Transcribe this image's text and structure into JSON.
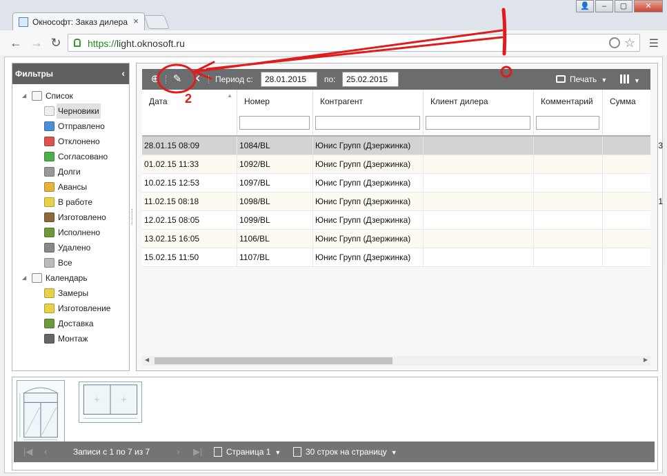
{
  "browser": {
    "tab_title": "Окнософт: Заказ дилера",
    "tab_close": "×",
    "url_scheme": "https://",
    "url_host": "light.oknosoft.ru",
    "window_buttons": [
      "👤",
      "–",
      "▢",
      "✕"
    ]
  },
  "sidebar": {
    "title": "Фильтры",
    "collapse_glyph": "‹",
    "groups": [
      {
        "label": "Список",
        "icon": "list-icon",
        "items": [
          {
            "label": "Черновики",
            "icon": "draft-icon",
            "color": "#eeeeee"
          },
          {
            "label": "Отправлено",
            "icon": "upload-icon",
            "color": "#4a90d9"
          },
          {
            "label": "Отклонено",
            "icon": "rejected-icon",
            "color": "#d9534f"
          },
          {
            "label": "Согласовано",
            "icon": "approved-icon",
            "color": "#4cae4c"
          },
          {
            "label": "Долги",
            "icon": "debt-icon",
            "color": "#999999"
          },
          {
            "label": "Авансы",
            "icon": "coins-icon",
            "color": "#e5b53a"
          },
          {
            "label": "В работе",
            "icon": "work-icon",
            "color": "#e8d24a"
          },
          {
            "label": "Изготовлено",
            "icon": "factory-icon",
            "color": "#8a6a3a"
          },
          {
            "label": "Исполнено",
            "icon": "truck-icon",
            "color": "#6a9a3a"
          },
          {
            "label": "Удалено",
            "icon": "trash-icon",
            "color": "#888888"
          },
          {
            "label": "Все",
            "icon": "all-icon",
            "color": "#bbbbbb"
          }
        ]
      },
      {
        "label": "Календарь",
        "icon": "clock-icon",
        "items": [
          {
            "label": "Замеры",
            "icon": "measure-icon",
            "color": "#e8d24a"
          },
          {
            "label": "Изготовление",
            "icon": "work-icon",
            "color": "#e8d24a"
          },
          {
            "label": "Доставка",
            "icon": "truck-icon",
            "color": "#6a9a3a"
          },
          {
            "label": "Монтаж",
            "icon": "hammer-icon",
            "color": "#666666"
          }
        ]
      }
    ]
  },
  "toolbar": {
    "period_from_label": "Период с:",
    "period_from": "28.01.2015",
    "period_to_label": "по:",
    "period_to": "25.02.2015",
    "print_label": "Печать"
  },
  "grid": {
    "columns": [
      "Дата",
      "Номер",
      "Контрагент",
      "Клиент дилера",
      "Комментарий",
      "Сумма"
    ],
    "rows": [
      [
        "28.01.15 08:09",
        "1084/BL",
        "Юнис Групп (Дзержинка)",
        "",
        "",
        "3"
      ],
      [
        "01.02.15 11:33",
        "1092/BL",
        "Юнис Групп (Дзержинка)",
        "",
        "",
        ""
      ],
      [
        "10.02.15 12:53",
        "1097/BL",
        "Юнис Групп (Дзержинка)",
        "",
        "",
        ""
      ],
      [
        "11.02.15 08:18",
        "1098/BL",
        "Юнис Групп (Дзержинка)",
        "",
        "",
        "1"
      ],
      [
        "12.02.15 08:05",
        "1099/BL",
        "Юнис Групп (Дзержинка)",
        "",
        "",
        ""
      ],
      [
        "13.02.15 16:05",
        "1106/BL",
        "Юнис Групп (Дзержинка)",
        "",
        "",
        ""
      ],
      [
        "15.02.15 11:50",
        "1107/BL",
        "Юнис Групп (Дзержинка)",
        "",
        "",
        ""
      ]
    ],
    "selected_row": 0
  },
  "pager": {
    "records": "Записи с 1 по 7 из 7",
    "page": "Страница 1",
    "per_page": "30 строк на страницу"
  },
  "annotation": {
    "number": "2",
    "color": "#e01b1b"
  }
}
